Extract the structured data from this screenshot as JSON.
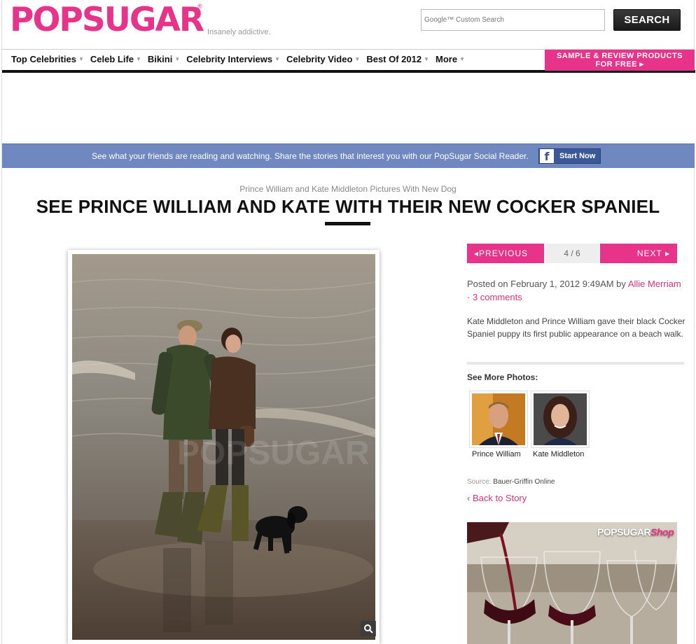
{
  "header": {
    "logo": "POPSUGAR",
    "tagline": "Insanely addictive.",
    "search_placeholder": "Google™ Custom Search",
    "search_button": "SEARCH"
  },
  "nav": {
    "items": [
      {
        "label": "Top Celebrities"
      },
      {
        "label": "Celeb Life"
      },
      {
        "label": "Bikini"
      },
      {
        "label": "Celebrity Interviews"
      },
      {
        "label": "Celebrity Video"
      },
      {
        "label": "Best Of 2012"
      },
      {
        "label": "More"
      }
    ],
    "promo_line1": "SAMPLE & REVIEW PRODUCTS",
    "promo_line2": "FOR FREE ▸"
  },
  "social_bar": {
    "text": "See what your friends are reading and watching. Share the stories that interest you with our PopSugar Social Reader.",
    "button": "Start Now"
  },
  "article": {
    "breadcrumb": "Prince William and Kate Middleton Pictures With New Dog",
    "title": "SEE PRINCE WILLIAM AND KATE WITH THEIR NEW COCKER SPANIEL"
  },
  "pager": {
    "previous": "◂PREVIOUS",
    "page": "4 / 6",
    "next": "NEXT ▸"
  },
  "post": {
    "posted_prefix": "Posted on February 1, 2012 9:49AM by ",
    "author": "Allie Merriam",
    "separator": "· ",
    "comments": "3 comments",
    "description": "Kate Middleton and Prince William gave their black Cocker Spaniel puppy its first public appearance on a beach walk."
  },
  "see_more": {
    "heading": "See More Photos:",
    "items": [
      {
        "label": "Prince William"
      },
      {
        "label": "Kate Middleton"
      }
    ]
  },
  "source": {
    "label": "Source:",
    "value": "Bauer-Griffin Online"
  },
  "back_link": "‹ Back to Story",
  "shop_ad": {
    "brand": "POPSUGAR",
    "brand_suffix": "Shop"
  },
  "colors": {
    "brand_pink": "#e8338a",
    "social_blue": "#6f88bf",
    "facebook_blue": "#3b5998"
  }
}
